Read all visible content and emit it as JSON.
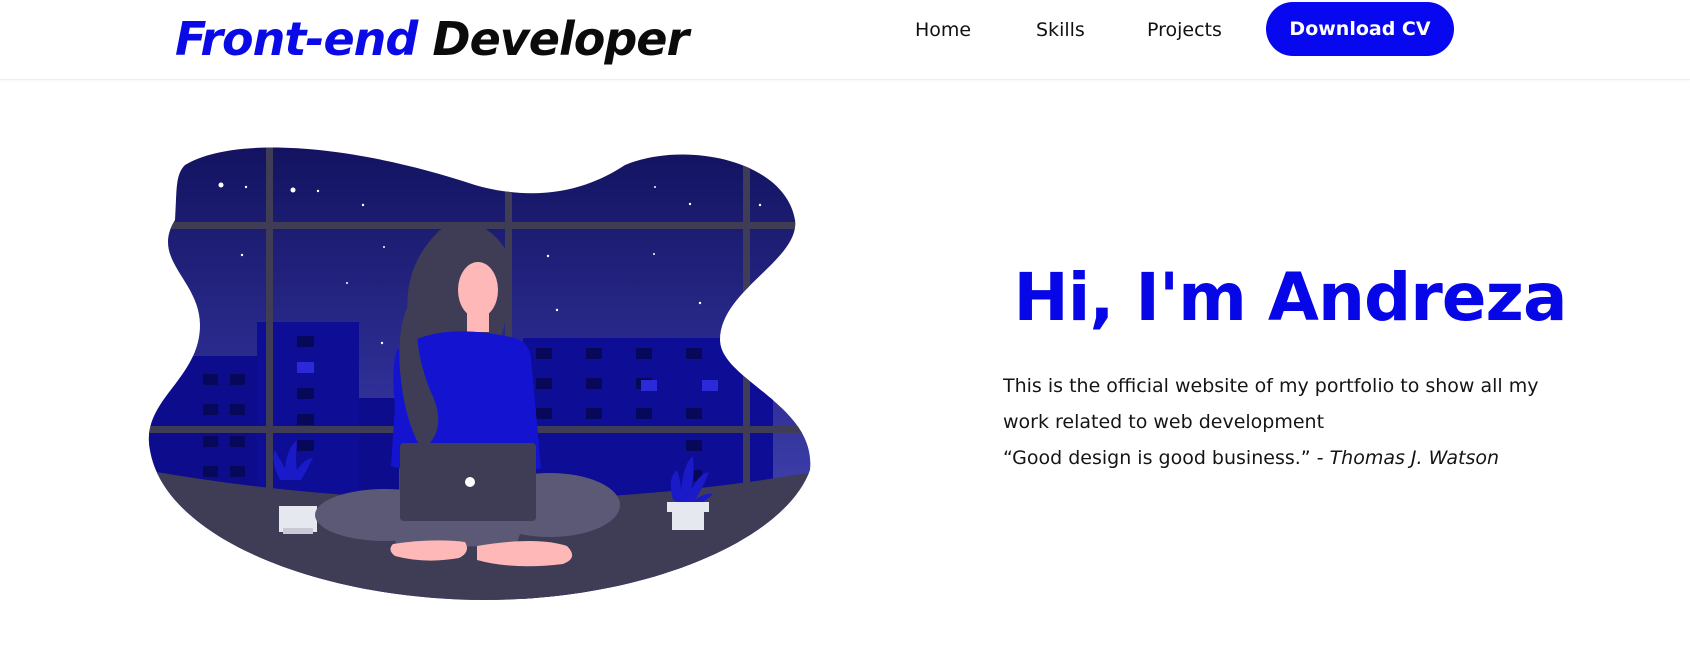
{
  "brand": {
    "accent": "Front-end",
    "rest": "Developer"
  },
  "nav": {
    "items": [
      {
        "label": "Home"
      },
      {
        "label": "Skills"
      },
      {
        "label": "Projects"
      }
    ],
    "cta_label": "Download CV"
  },
  "hero": {
    "title": "Hi, I'm Andreza",
    "description_line1": "This is the official website of my portfolio to show all my",
    "description_line2": "work related to web development",
    "quote": "“Good design is good business.” ",
    "quote_author": "- Thomas J. Watson"
  },
  "illustration": {
    "name": "woman-with-laptop-at-night-window",
    "colors": {
      "sky_top": "#14146a",
      "sky_bottom": "#4a4ab8",
      "buildings": "#0c0c9a",
      "accent": "#0a0ae6",
      "dark": "#3f3d56",
      "skin": "#ffb8b8"
    }
  },
  "theme": {
    "accent": "#0a0ae6",
    "text": "#111111",
    "background": "#ffffff"
  }
}
